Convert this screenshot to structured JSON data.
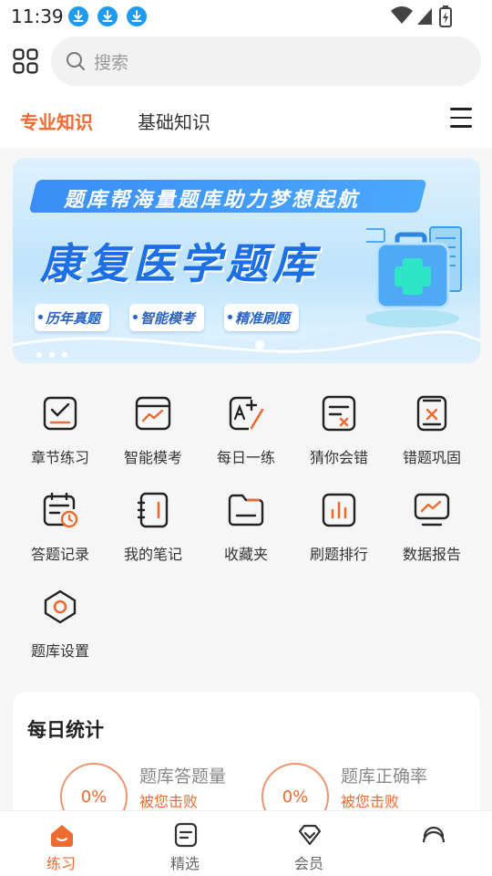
{
  "status": {
    "time": "11:39"
  },
  "search": {
    "placeholder": "搜索"
  },
  "tabs": [
    {
      "label": "专业知识",
      "active": true
    },
    {
      "label": "基础知识",
      "active": false
    }
  ],
  "banner": {
    "ribbon": "题库帮海量题库助力梦想起航",
    "headline": "康复医学题库",
    "pills": [
      "历年真题",
      "智能模考",
      "精准刷题"
    ]
  },
  "tools": [
    {
      "label": "章节练习",
      "icon": "chapter-practice-icon"
    },
    {
      "label": "智能模考",
      "icon": "smart-mock-exam-icon"
    },
    {
      "label": "每日一练",
      "icon": "daily-practice-icon"
    },
    {
      "label": "猜你会错",
      "icon": "guess-mistake-icon"
    },
    {
      "label": "错题巩固",
      "icon": "wrong-question-icon"
    },
    {
      "label": "答题记录",
      "icon": "answer-record-icon"
    },
    {
      "label": "我的笔记",
      "icon": "notes-icon"
    },
    {
      "label": "收藏夹",
      "icon": "favorites-folder-icon"
    },
    {
      "label": "刷题排行",
      "icon": "ranking-chart-icon"
    },
    {
      "label": "数据报告",
      "icon": "data-report-icon"
    },
    {
      "label": "题库设置",
      "icon": "settings-icon"
    }
  ],
  "stats": {
    "title": "每日统计",
    "items": [
      {
        "value": "0%",
        "title": "题库答题量",
        "sub": "被您击败"
      },
      {
        "value": "0%",
        "title": "题库正确率",
        "sub": "被您击败"
      }
    ]
  },
  "nav": [
    {
      "label": "练习",
      "active": true
    },
    {
      "label": "精选",
      "active": false
    },
    {
      "label": "会员",
      "active": false
    },
    {
      "label": "",
      "active": false
    }
  ],
  "colors": {
    "accent": "#ee6a2f",
    "banner_blue": "#1d6fe6"
  }
}
